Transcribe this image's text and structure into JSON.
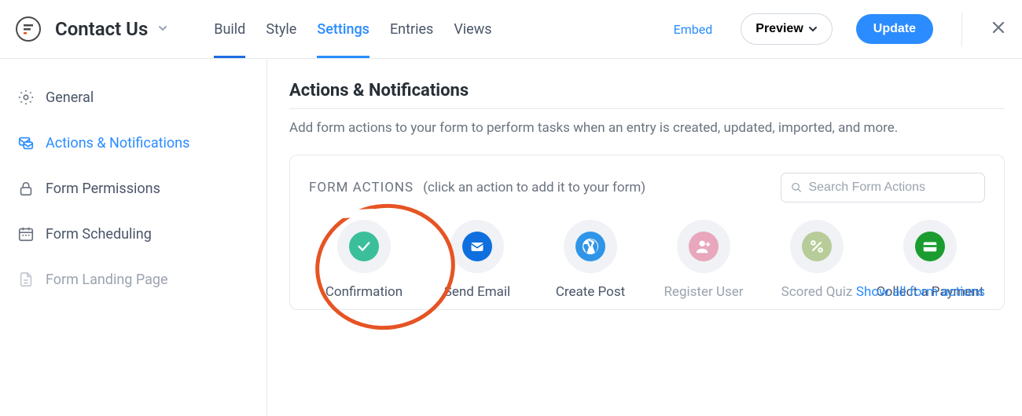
{
  "header": {
    "title": "Contact Us",
    "tabs": {
      "build": "Build",
      "style": "Style",
      "settings": "Settings",
      "entries": "Entries",
      "views": "Views"
    },
    "embed": "Embed",
    "preview": "Preview",
    "update": "Update"
  },
  "sidebar": {
    "general": "General",
    "actions": "Actions & Notifications",
    "permissions": "Form Permissions",
    "scheduling": "Form Scheduling",
    "landing": "Form Landing Page"
  },
  "main": {
    "heading": "Actions & Notifications",
    "desc": "Add form actions to your form to perform tasks when an entry is created, updated, imported, and more."
  },
  "panel": {
    "title": "FORM ACTIONS",
    "hint": "(click an action to add it to your form)",
    "search_placeholder": "Search Form Actions",
    "showall": "Show all form actions"
  },
  "actions": {
    "confirmation": "Confirmation",
    "send_email": "Send Email",
    "create_post": "Create Post",
    "register_user": "Register User",
    "scored_quiz": "Scored Quiz",
    "collect_payment": "Collect a Payment"
  }
}
